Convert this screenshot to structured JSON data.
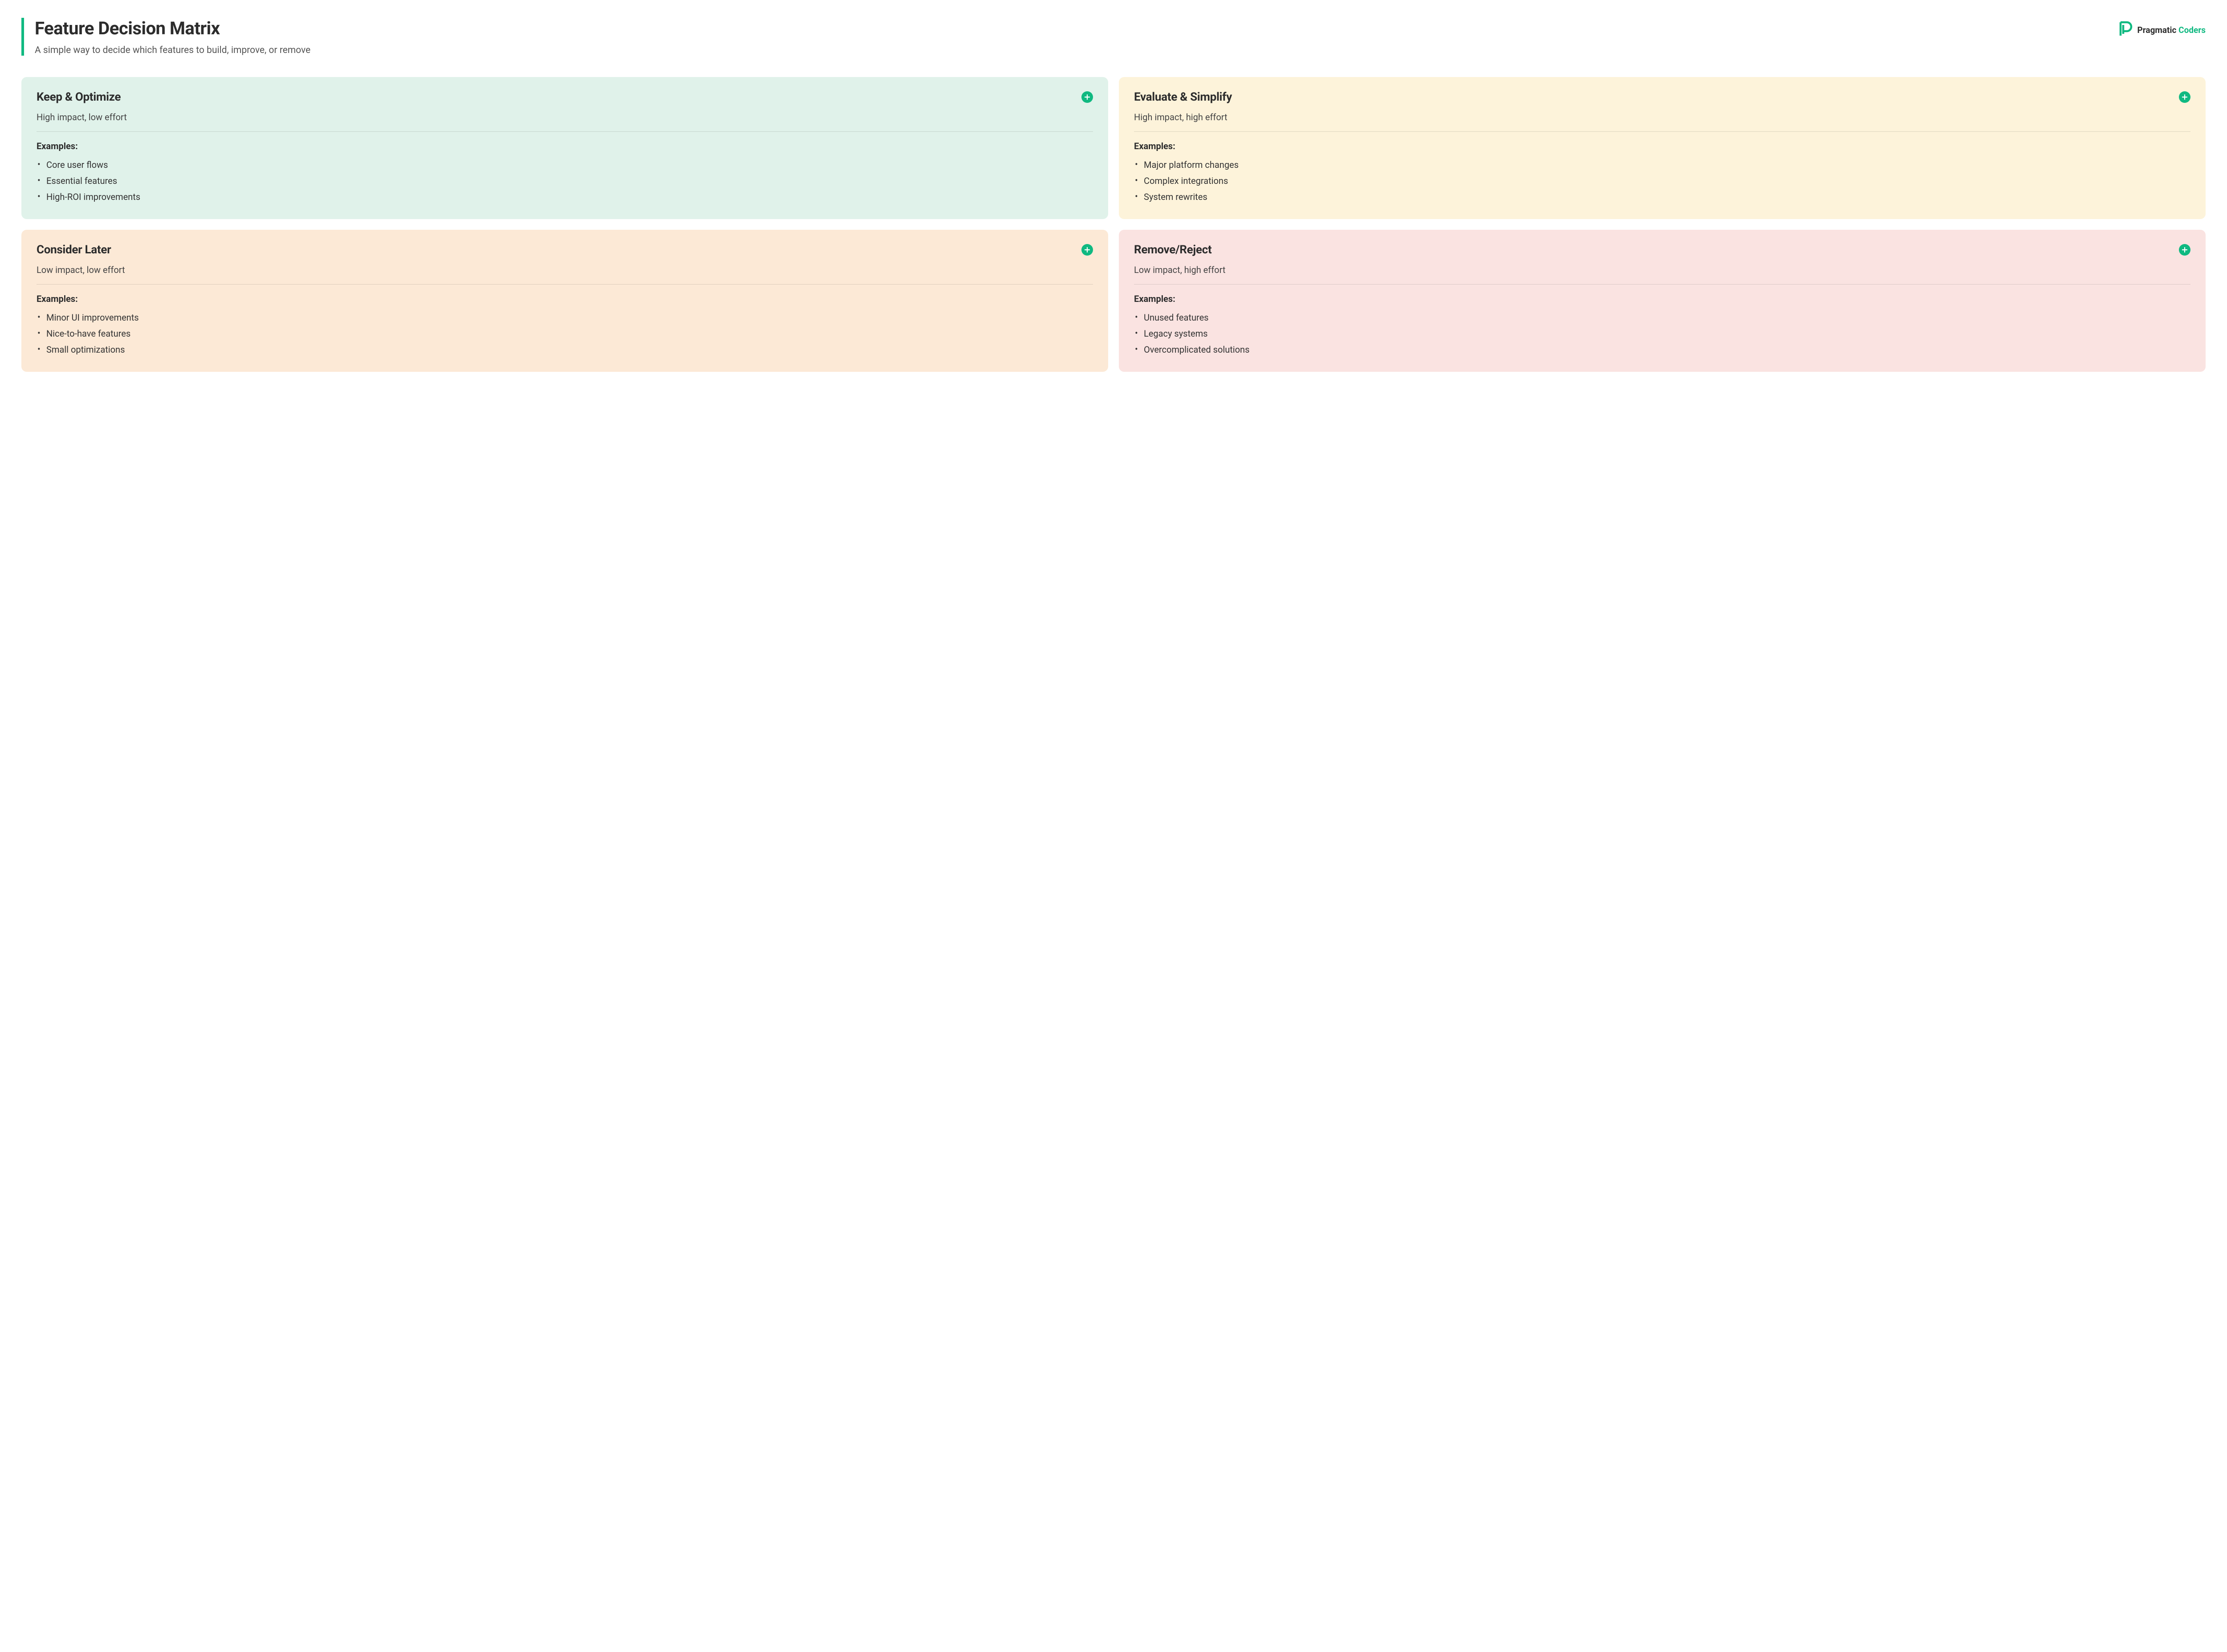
{
  "header": {
    "title": "Feature Decision Matrix",
    "subtitle": "A simple way to decide which features to build, improve, or remove"
  },
  "brand": {
    "word1": "Pragmatic",
    "word2": "Coders"
  },
  "quadrants": [
    {
      "title": "Keep & Optimize",
      "subtitle": "High impact, low effort",
      "examples_label": "Examples:",
      "examples": [
        "Core user flows",
        "Essential features",
        "High-ROI improvements"
      ],
      "color": "green"
    },
    {
      "title": "Evaluate & Simplify",
      "subtitle": "High impact, high effort",
      "examples_label": "Examples:",
      "examples": [
        "Major platform changes",
        "Complex integrations",
        "System rewrites"
      ],
      "color": "cream"
    },
    {
      "title": "Consider Later",
      "subtitle": "Low impact, low effort",
      "examples_label": "Examples:",
      "examples": [
        "Minor UI improvements",
        "Nice-to-have features",
        "Small optimizations"
      ],
      "color": "peach"
    },
    {
      "title": "Remove/Reject",
      "subtitle": "Low impact, high effort",
      "examples_label": "Examples:",
      "examples": [
        "Unused features",
        "Legacy systems",
        "Overcomplicated solutions"
      ],
      "color": "pink"
    }
  ]
}
